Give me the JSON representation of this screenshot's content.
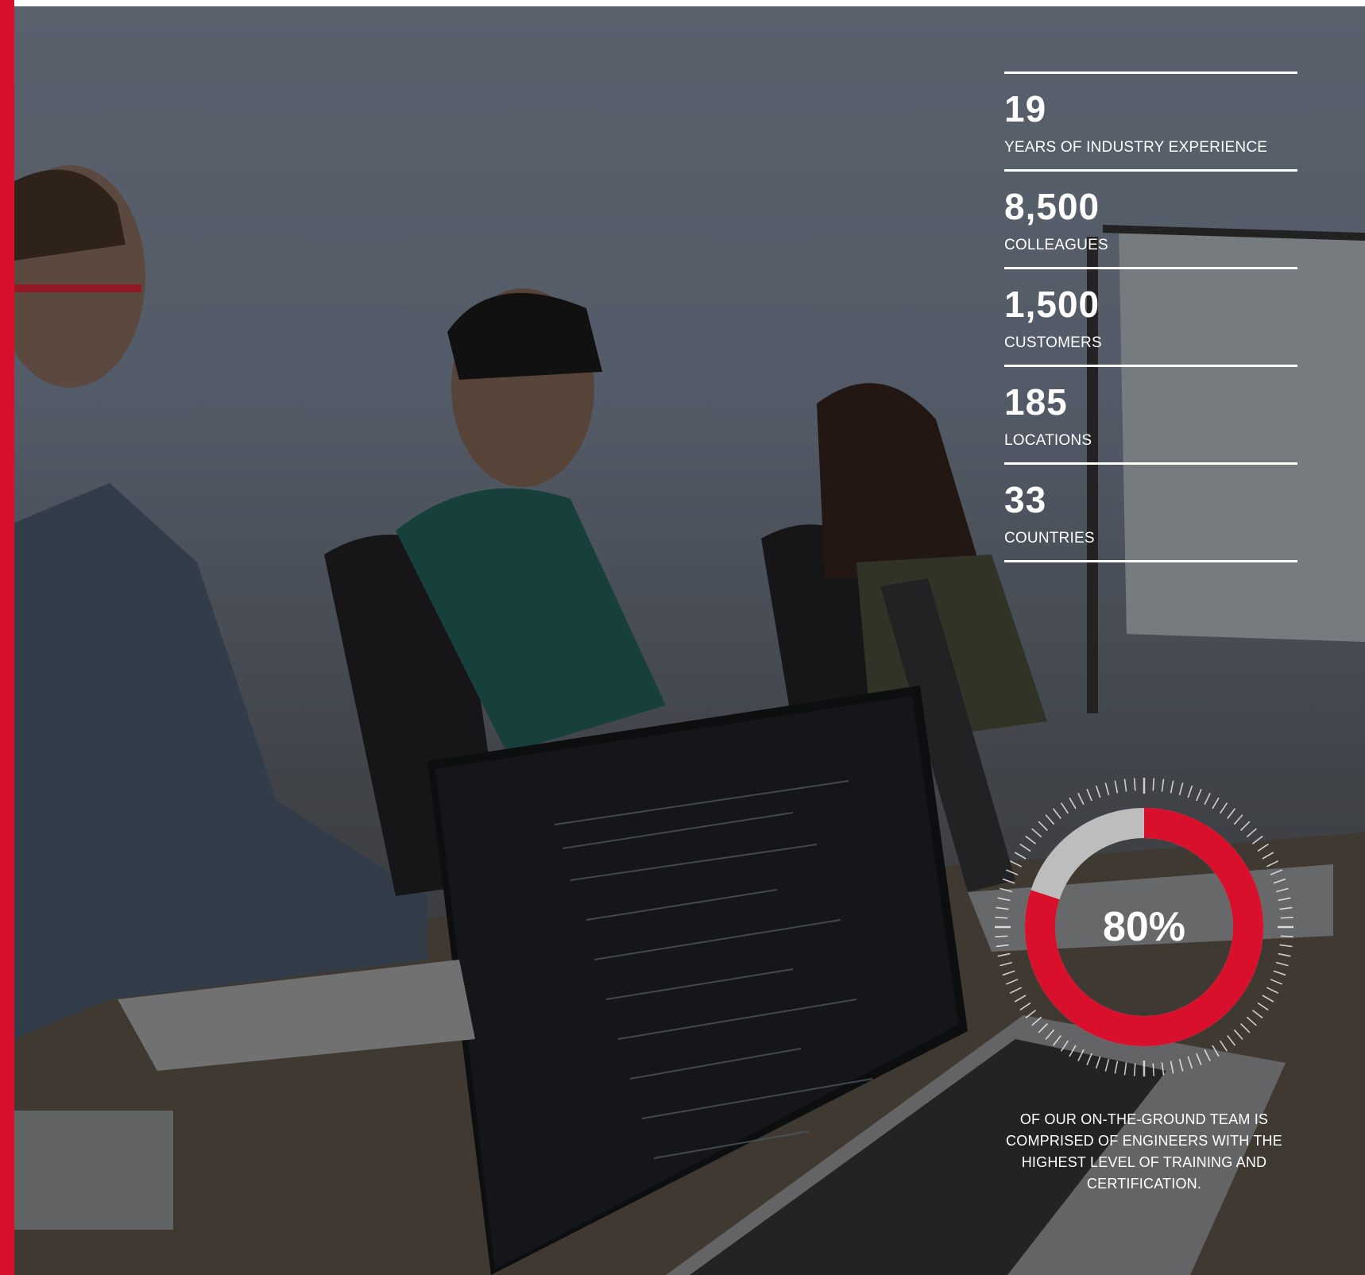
{
  "stats": [
    {
      "value": "19",
      "label": "YEARS OF INDUSTRY EXPERIENCE"
    },
    {
      "value": "8,500",
      "label": "COLLEAGUES"
    },
    {
      "value": "1,500",
      "label": "CUSTOMERS"
    },
    {
      "value": "185",
      "label": "LOCATIONS"
    },
    {
      "value": "33",
      "label": "COUNTRIES"
    }
  ],
  "gauge": {
    "value_label": "80%",
    "fraction": 0.8,
    "caption": "OF OUR ON-THE-GROUND TEAM IS COMPRISED OF ENGINEERS WITH THE HIGHEST LEVEL OF TRAINING AND CERTIFICATION."
  },
  "colors": {
    "accent": "#d9102b",
    "gauge_track": "#bdbdbd",
    "text": "#ffffff"
  },
  "icons": {
    "gauge_ticks": "dial-ticks-icon"
  }
}
